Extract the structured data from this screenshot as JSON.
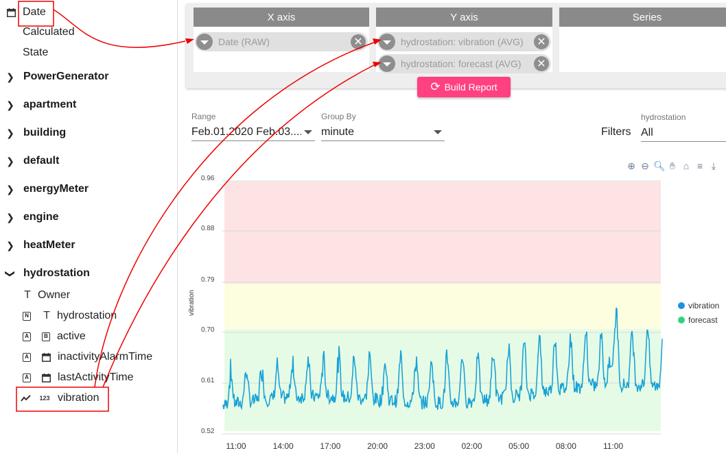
{
  "sidebar": {
    "date_items": [
      {
        "label": "Date"
      },
      {
        "label": "Calculated"
      },
      {
        "label": "State"
      }
    ],
    "groups": [
      {
        "label": "PowerGenerator"
      },
      {
        "label": "apartment"
      },
      {
        "label": "building"
      },
      {
        "label": "default"
      },
      {
        "label": "energyMeter"
      },
      {
        "label": "engine"
      },
      {
        "label": "heatMeter"
      },
      {
        "label": "hydrostation"
      }
    ],
    "hydro_fields": [
      {
        "label": "Owner",
        "badge": "",
        "type_icon": "T"
      },
      {
        "label": "hydrostation",
        "badge": "N",
        "type_icon": "T"
      },
      {
        "label": "active",
        "badge": "A",
        "type_icon": "B"
      },
      {
        "label": "inactivityAlarmTime",
        "badge": "A",
        "type_icon": "calendar"
      },
      {
        "label": "lastActivityTime",
        "badge": "A",
        "type_icon": "calendar"
      },
      {
        "label": "vibration",
        "badge": "",
        "type_icon": "123"
      }
    ]
  },
  "query": {
    "x_axis": {
      "title": "X axis",
      "chips": [
        "Date (RAW)"
      ]
    },
    "y_axis": {
      "title": "Y axis",
      "chips": [
        "hydrostation: vibration (AVG)",
        "hydrostation: forecast (AVG)"
      ]
    },
    "series": {
      "title": "Series"
    },
    "build_label": "Build Report"
  },
  "filters": {
    "range_label": "Range",
    "range_value": "Feb.01.2020 Feb.03....",
    "groupby_label": "Group By",
    "groupby_value": "minute",
    "filters_label": "Filters",
    "hydro_label": "hydrostation",
    "hydro_value": "All"
  },
  "chart_data": {
    "type": "line",
    "ylabel": "vibration",
    "yticks": [
      "0.96",
      "0.88",
      "0.79",
      "0.70",
      "0.61",
      "0.52"
    ],
    "xticks": [
      "11:00",
      "14:00",
      "17:00",
      "20:00",
      "23:00",
      "02:00",
      "05:00",
      "08:00",
      "11:00"
    ],
    "ylim": [
      0.52,
      0.96
    ],
    "bands": [
      {
        "from": 0.52,
        "to": 0.7,
        "color": "#e6fbe6"
      },
      {
        "from": 0.7,
        "to": 0.78,
        "color": "#fdfde0"
      },
      {
        "from": 0.78,
        "to": 0.96,
        "color": "#fde3e3"
      }
    ],
    "series": [
      {
        "name": "vibration",
        "color": "#1e90e0"
      },
      {
        "name": "forecast",
        "color": "#2ed47a"
      }
    ],
    "line_color": "#1aa3d6",
    "legend_position": "right"
  }
}
